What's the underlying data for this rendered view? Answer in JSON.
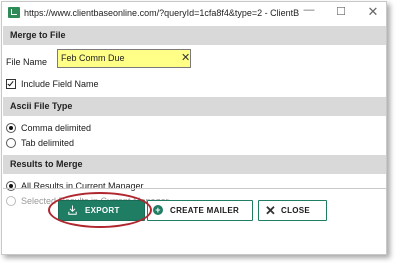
{
  "window": {
    "url": "https://www.clientbaseonline.com/?queryId=1cfa8f4&type=2 - ClientB...",
    "minimize_glyph": "—",
    "maximize_glyph": "☐",
    "close_glyph": "✕"
  },
  "sections": {
    "merge_to_file": {
      "title": "Merge to File",
      "file_name_label": "File Name",
      "file_name_value": "Feb Comm Due",
      "include_field_name_label": "Include Field Name",
      "include_field_name_checked": true
    },
    "ascii_file_type": {
      "title": "Ascii File Type",
      "options": [
        "Comma delimited",
        "Tab delimited"
      ],
      "selected": "Comma delimited"
    },
    "results_to_merge": {
      "title": "Results to Merge",
      "options": [
        "All Results in Current Manager",
        "Selected Results in Current Manager"
      ],
      "selected": "All Results in Current Manager"
    }
  },
  "buttons": {
    "export": "EXPORT",
    "create_mailer": "CREATE MAILER",
    "close": "CLOSE"
  },
  "colors": {
    "accent": "#1f7d64",
    "input_highlight": "#ffff88",
    "section_header_bg": "#d9d9d9",
    "annotation_ring": "#b0262e"
  }
}
